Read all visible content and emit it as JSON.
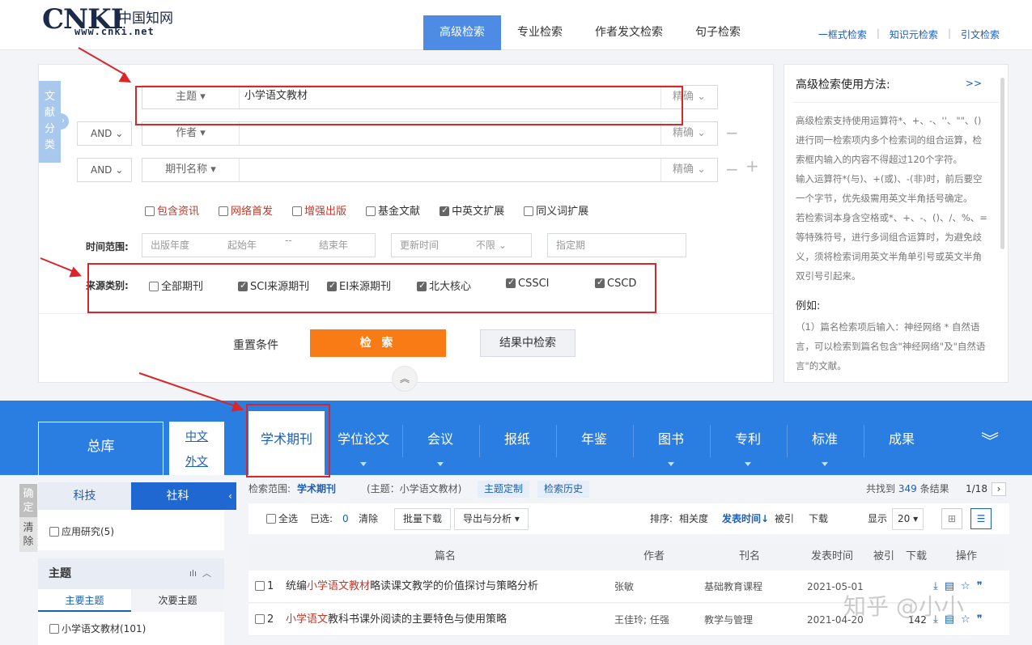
{
  "header": {
    "logo_main": "CNKI",
    "logo_cn": "中国知网",
    "logo_url": "www.cnki.net",
    "tabs": [
      "高级检索",
      "专业检索",
      "作者发文检索",
      "句子检索"
    ],
    "links": [
      "一框式检索",
      "知识元检索",
      "引文检索"
    ]
  },
  "panel": {
    "classify_label": "文献分类",
    "rows": [
      {
        "logic": "",
        "field": "主题",
        "value": "小学语文教材",
        "match": "精确"
      },
      {
        "logic": "AND",
        "field": "作者",
        "value": "",
        "match": "精确"
      },
      {
        "logic": "AND",
        "field": "期刊名称",
        "value": "",
        "match": "精确"
      }
    ],
    "options": [
      {
        "label": "包含资讯",
        "checked": false,
        "red": true
      },
      {
        "label": "网络首发",
        "checked": false,
        "red": true
      },
      {
        "label": "增强出版",
        "checked": false,
        "red": true
      },
      {
        "label": "基金文献",
        "checked": false,
        "red": false
      },
      {
        "label": "中英文扩展",
        "checked": true,
        "red": false
      },
      {
        "label": "同义词扩展",
        "checked": false,
        "red": false
      }
    ],
    "time_label": "时间范围:",
    "time": {
      "pub_year": "出版年度",
      "start_year": "起始年",
      "dash": "--",
      "end_year": "结束年",
      "update_time": "更新时间",
      "unlimited": "不限",
      "issue": "指定期"
    },
    "source_label": "来源类别:",
    "sources": [
      {
        "label": "全部期刊",
        "checked": false
      },
      {
        "label": "SCI来源期刊",
        "checked": true
      },
      {
        "label": "EI来源期刊",
        "checked": true
      },
      {
        "label": "北大核心",
        "checked": true
      },
      {
        "label": "CSSCI",
        "checked": true
      },
      {
        "label": "CSCD",
        "checked": true
      }
    ],
    "reset": "重置条件",
    "search": "检 索",
    "in_result": "结果中检索"
  },
  "help": {
    "title": "高级检索使用方法:",
    "more": ">>",
    "p1": "高级检索支持使用运算符*、+、-、''、\"\"、()进行同一检索项内多个检索词的组合运算，检索框内输入的内容不得超过120个字符。",
    "p2": "输入运算符*(与)、+(或)、-(非)时，前后要空一个字节，优先级需用英文半角括号确定。",
    "p3": "若检索词本身含空格或*、+、-、()、/、%、=等特殊符号，进行多词组合运算时，为避免歧义，须将检索词用英文半角单引号或英文半角双引号引起来。",
    "example": "例如:",
    "p4": "（1）篇名检索项后输入：神经网络 * 自然语言，可以检索到篇名包含\"神经网络\"及\"自然语言\"的文献。"
  },
  "dbbar": {
    "zongku": "总库",
    "lang_cn": "中文",
    "lang_en": "外文",
    "items": [
      "学术期刊",
      "学位论文",
      "会议",
      "报纸",
      "年鉴",
      "图书",
      "专利",
      "标准",
      "成果"
    ]
  },
  "left": {
    "confirm": "确定",
    "clear": "清除",
    "tabs": [
      "科技",
      "社科"
    ],
    "applied": "应用研究(5)",
    "topic_title": "主题",
    "topic_tabs": [
      "主要主题",
      "次要主题"
    ],
    "topic_item": "小学语文教材(101)"
  },
  "results": {
    "scope_label": "检索范围:",
    "scope_value": "学术期刊",
    "query": "(主题：小学语文教材)",
    "btn_define": "主题定制",
    "btn_history": "检索历史",
    "found_prefix": "共找到",
    "found_count": "349",
    "found_suffix": "条结果",
    "page": "1/18",
    "select_all": "全选",
    "selected_label": "已选:",
    "selected_count": "0",
    "clear": "清除",
    "batch_download": "批量下载",
    "export": "导出与分析",
    "sort_label": "排序:",
    "sort_relevance": "相关度",
    "sort_time": "发表时间",
    "sort_cited": "被引",
    "sort_download": "下载",
    "show_label": "显示",
    "show_count": "20",
    "columns": [
      "篇名",
      "作者",
      "刊名",
      "发表时间",
      "被引",
      "下载",
      "操作"
    ],
    "rows": [
      {
        "no": "1",
        "pre": "统编",
        "hl": "小学语文教材",
        "post": "略读课文教学的价值探讨与策略分析",
        "author": "张敏",
        "journal": "基础教育课程",
        "date": "2021-05-01",
        "cited": "",
        "downloads": ""
      },
      {
        "no": "2",
        "pre": "",
        "hl": "小学语文",
        "post": "教科书课外阅读的主要特色与使用策略",
        "author": "王佳玲; 任强",
        "journal": "教学与管理",
        "date": "2021-04-20",
        "cited": "",
        "downloads": "142"
      }
    ]
  },
  "watermark": "知乎 @小小",
  "colors": {
    "accent": "#2a7de1",
    "orange": "#f97b16",
    "annotation": "#d8262b"
  }
}
